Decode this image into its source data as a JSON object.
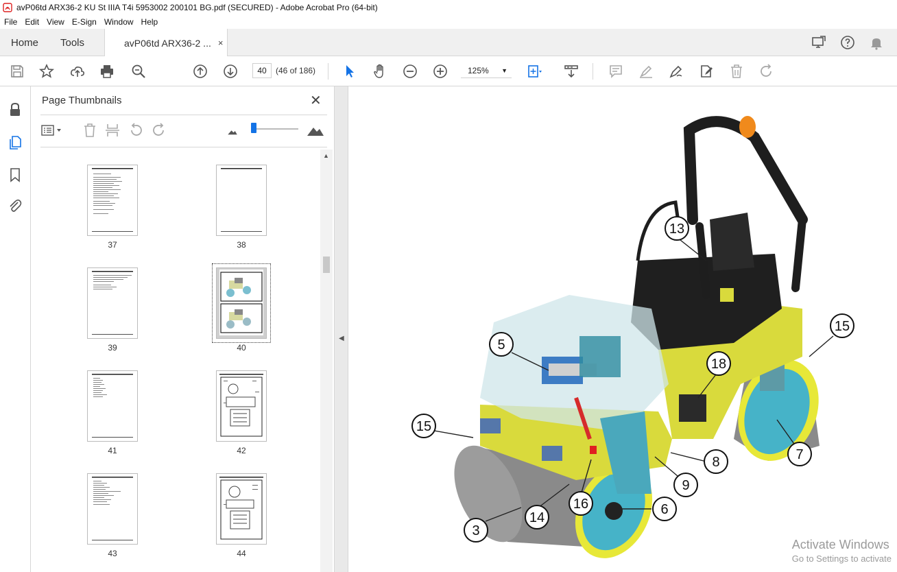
{
  "window": {
    "title": "avP06td ARX36-2 KU St IIIA T4i 5953002 200101 BG.pdf (SECURED) - Adobe Acrobat Pro (64-bit)"
  },
  "menu": {
    "items": [
      "File",
      "Edit",
      "View",
      "E-Sign",
      "Window",
      "Help"
    ]
  },
  "tabs": {
    "home": "Home",
    "tools": "Tools",
    "doc": "avP06td ARX36-2 ...",
    "close": "×"
  },
  "toolbar": {
    "page_value": "40",
    "page_count": "(46 of 186)",
    "zoom": "125%"
  },
  "panel": {
    "title": "Page Thumbnails",
    "close": "✕",
    "pages": [
      "37",
      "38",
      "39",
      "40",
      "41",
      "42",
      "43",
      "44"
    ],
    "selected_page": "40"
  },
  "figure": {
    "callouts": [
      "13",
      "15",
      "5",
      "18",
      "15",
      "7",
      "8",
      "9",
      "16",
      "6",
      "14",
      "3"
    ]
  },
  "watermark": {
    "line1": "Activate Windows",
    "line2": "Go to Settings to activate"
  },
  "colors": {
    "accent": "#1473e6",
    "machine_yellow": "#e8ea3a",
    "drum_cyan": "#46b3c8"
  }
}
